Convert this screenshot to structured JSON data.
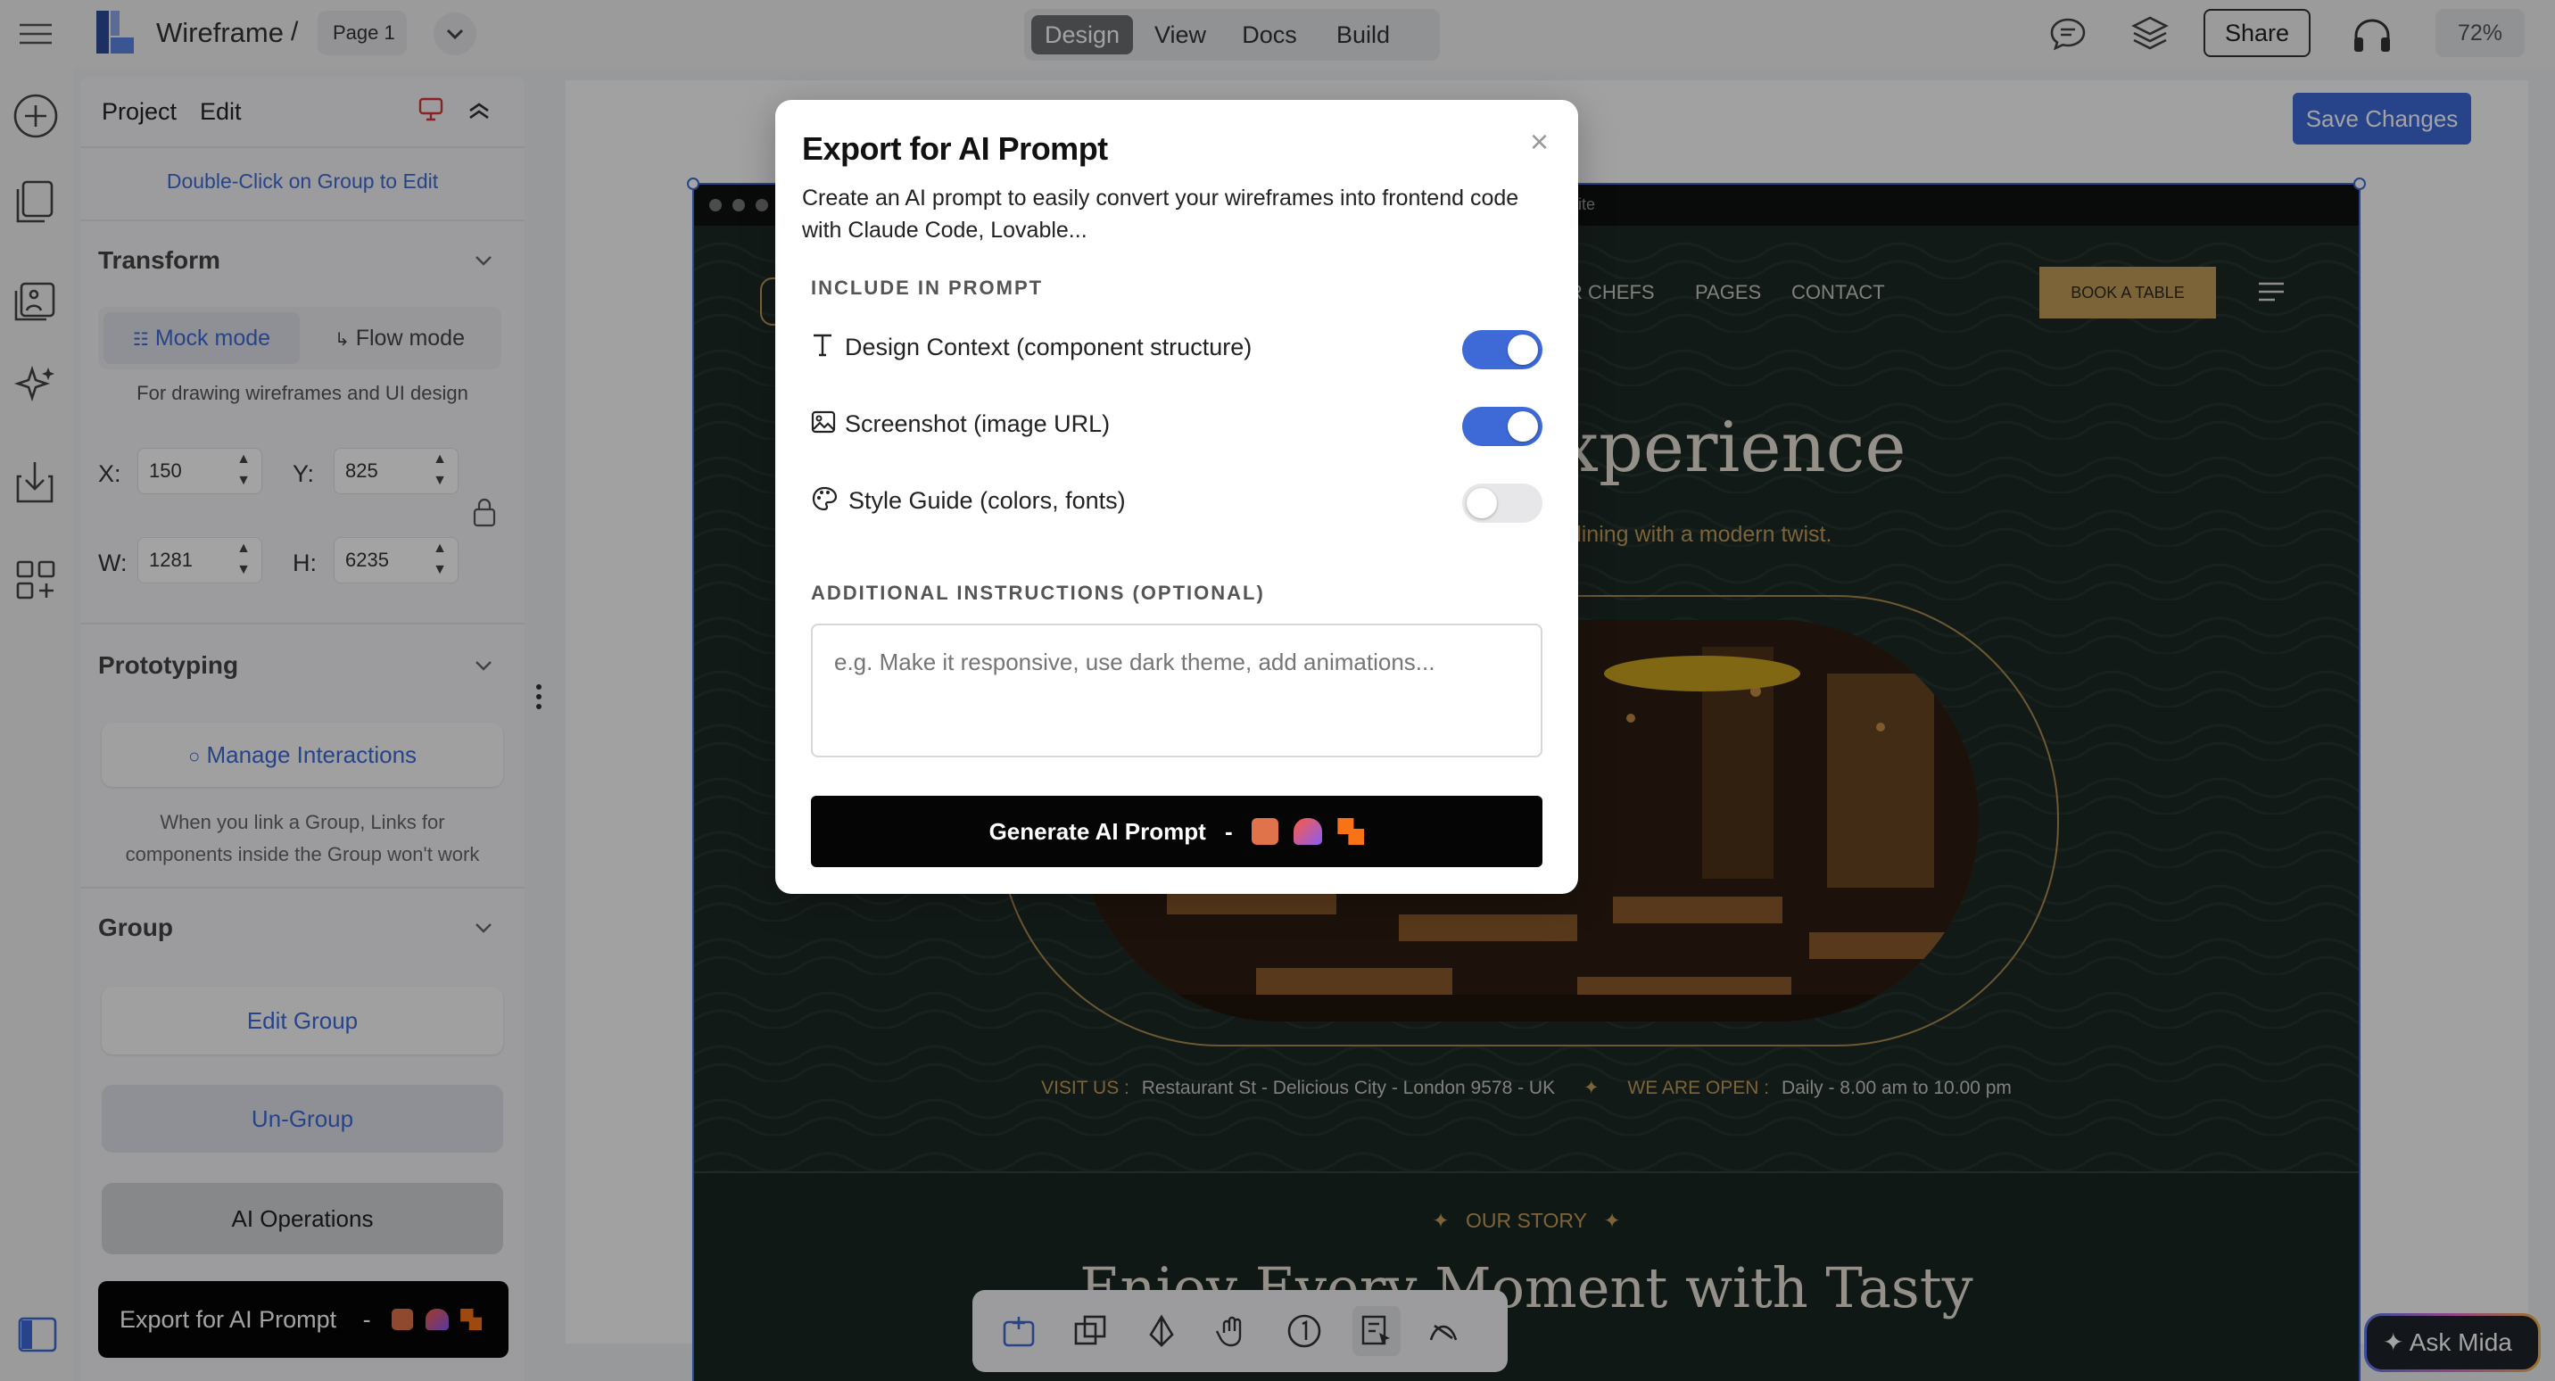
{
  "app": {
    "name": "Wireframe",
    "separator": "/",
    "page": "Page 1"
  },
  "mode_tabs": [
    "Design",
    "View",
    "Docs",
    "Build"
  ],
  "topbar_right": {
    "share_label": "Share",
    "zoom": "72%"
  },
  "panel": {
    "tabs": [
      "Project",
      "Edit"
    ],
    "hint": "Double-Click on Group to Edit",
    "transform": {
      "title": "Transform",
      "mock_mode": "Mock mode",
      "flow_mode": "Flow mode",
      "note": "For drawing wireframes and UI design",
      "x_label": "X:",
      "x_value": "150",
      "y_label": "Y:",
      "y_value": "825",
      "w_label": "W:",
      "w_value": "1281",
      "h_label": "H:",
      "h_value": "6235"
    },
    "prototyping": {
      "title": "Prototyping",
      "manage": "Manage Interactions",
      "note_line1": "When you link a Group, Links for",
      "note_line2": "components inside the Group won't work"
    },
    "group": {
      "title": "Group",
      "edit": "Edit Group",
      "ungroup": "Un-Group",
      "ai_ops": "AI Operations",
      "export": "Export for AI Prompt",
      "export_sep": "-"
    }
  },
  "canvas": {
    "save_changes": "Save Changes",
    "ask_mida": "Ask Mida",
    "site": {
      "browser_url": "site",
      "nav": [
        "R CHEFS",
        "PAGES",
        "CONTACT"
      ],
      "book": "BOOK A TABLE",
      "hero_title": "xperience",
      "hero_sub": "e dining with a modern twist.",
      "visit_label": "VISIT US :",
      "visit_value": "Restaurant St - Delicious City - London 9578 - UK",
      "open_label": "WE ARE OPEN :",
      "open_value": "Daily - 8.00 am to 10.00 pm",
      "story_label": "OUR STORY",
      "story_title": "Enjoy Every Moment with Tasty"
    }
  },
  "modal": {
    "title": "Export for AI Prompt",
    "description": "Create an AI prompt to easily convert your wireframes into frontend code with Claude Code, Lovable...",
    "close": "×",
    "include_heading": "INCLUDE IN PROMPT",
    "options": [
      {
        "label": "Design Context (component structure)",
        "enabled": true,
        "icon": "text-icon"
      },
      {
        "label": "Screenshot (image URL)",
        "enabled": true,
        "icon": "image-icon"
      },
      {
        "label": "Style Guide (colors, fonts)",
        "enabled": false,
        "icon": "palette-icon"
      }
    ],
    "instructions_heading": "ADDITIONAL INSTRUCTIONS (OPTIONAL)",
    "instructions_placeholder": "e.g. Make it responsive, use dark theme, add animations...",
    "generate_label": "Generate AI Prompt",
    "generate_sep": "-"
  },
  "colors": {
    "accent": "#3d6ad6",
    "site_bg": "#1d2a26",
    "gold": "#c29d58",
    "overlay": "rgba(0,0,0,0.36)"
  }
}
